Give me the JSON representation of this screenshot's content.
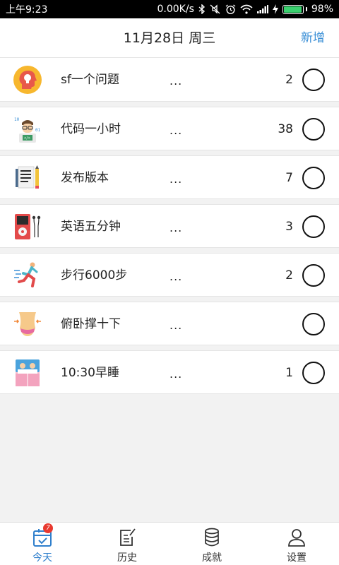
{
  "status_bar": {
    "time": "上午9:23",
    "speed": "0.00K/s",
    "battery": "98%",
    "battery_level": 0.98,
    "icons": [
      "bluetooth-icon",
      "mute-icon",
      "alarm-icon",
      "wifi-icon",
      "signal-icon",
      "charging-icon",
      "battery-icon"
    ]
  },
  "header": {
    "title": "11月28日 周三",
    "add_label": "新增"
  },
  "colors": {
    "accent": "#3a8fd6",
    "background": "#f2f2f2",
    "badge": "#e8392f"
  },
  "tasks": [
    {
      "icon": "head-lightbulb-icon",
      "name": "sf一个问题",
      "more": "...",
      "count": "2"
    },
    {
      "icon": "programmer-icon",
      "name": "代码一小时",
      "more": "...",
      "count": "38"
    },
    {
      "icon": "document-pencil-icon",
      "name": "发布版本",
      "more": "...",
      "count": "7"
    },
    {
      "icon": "music-player-icon",
      "name": "英语五分钟",
      "more": "...",
      "count": "3"
    },
    {
      "icon": "runner-icon",
      "name": "步行6000步",
      "more": "...",
      "count": "2"
    },
    {
      "icon": "waist-icon",
      "name": "俯卧撑十下",
      "more": "...",
      "count": ""
    },
    {
      "icon": "bed-icon",
      "name": "10:30早睡",
      "more": "...",
      "count": "1"
    }
  ],
  "tabbar": {
    "tabs": [
      {
        "icon": "calendar-check-icon",
        "label": "今天",
        "badge": "7",
        "active": true
      },
      {
        "icon": "history-note-icon",
        "label": "历史"
      },
      {
        "icon": "coin-stack-icon",
        "label": "成就"
      },
      {
        "icon": "user-icon",
        "label": "设置"
      }
    ]
  }
}
